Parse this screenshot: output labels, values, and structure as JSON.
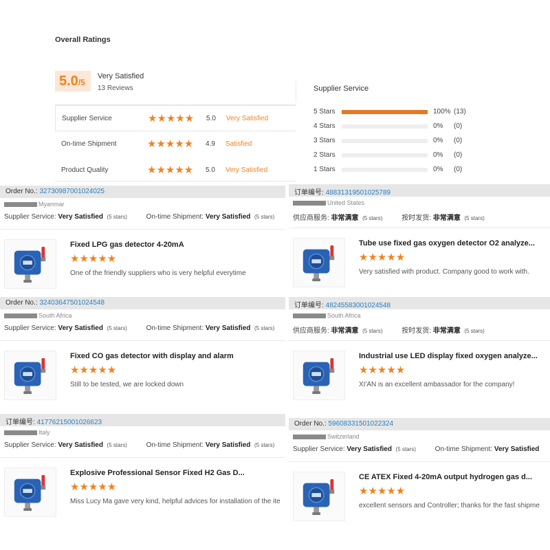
{
  "overall": {
    "title": "Overall Ratings",
    "score": "5.0",
    "score_den": "/5",
    "label": "Very Satisfied",
    "reviews": "13 Reviews"
  },
  "ratings": [
    {
      "label": "Supplier Service",
      "stars": "★★★★★",
      "score": "5.0",
      "word": "Very Satisfied"
    },
    {
      "label": "On-time Shipment",
      "stars": "★★★★★",
      "score": "4.9",
      "word": "Satisfied"
    },
    {
      "label": "Product Quality",
      "stars": "★★★★★",
      "score": "5.0",
      "word": "Very Satisfied"
    }
  ],
  "distribution": {
    "title": "Supplier Service",
    "rows": [
      {
        "label": "5 Stars",
        "pct": "100%",
        "count": "(13)",
        "fraction": 1.0
      },
      {
        "label": "4 Stars",
        "pct": "0%",
        "count": "(0)",
        "fraction": 0
      },
      {
        "label": "3 Stars",
        "pct": "0%",
        "count": "(0)",
        "fraction": 0
      },
      {
        "label": "2 Stars",
        "pct": "0%",
        "count": "(0)",
        "fraction": 0
      },
      {
        "label": "1 Stars",
        "pct": "0%",
        "count": "(0)",
        "fraction": 0
      }
    ]
  },
  "reviews": [
    {
      "order_label": "Order No.:",
      "order_no": "32730987001024025",
      "country": "Myanmar",
      "svc_label": "Supplier Service:",
      "svc_value": "Very Satisfied",
      "svc_stars": "(5 stars)",
      "ship_label": "On-time Shipment:",
      "ship_value": "Very Satisfied",
      "ship_stars": "(5 stars)",
      "product": "Fixed LPG gas detector 4-20mA",
      "stars": "★★★★★",
      "comment": "One of the friendly suppliers who is very helpful everytime"
    },
    {
      "order_label": "订单编号:",
      "order_no": "48831319501025789",
      "country": "United States",
      "svc_label": "供应商服务:",
      "svc_value": "非常满意",
      "svc_stars": "(5 stars)",
      "ship_label": "按时发货:",
      "ship_value": "非常满意",
      "ship_stars": "(5 stars)",
      "product": "Tube use fixed gas oxygen detector O2 analyze...",
      "stars": "★★★★★",
      "comment": "Very satisfied with product. Company good to work with."
    },
    {
      "order_label": "Order No.:",
      "order_no": "32403647501024548",
      "country": "South Africa",
      "svc_label": "Supplier Service:",
      "svc_value": "Very Satisfied",
      "svc_stars": "(5 stars)",
      "ship_label": "On-time Shipment:",
      "ship_value": "Very Satisfied",
      "ship_stars": "(5 stars)",
      "product": "Fixed CO gas detector with display and alarm",
      "stars": "★★★★★",
      "comment": "Still to be tested, we are locked down"
    },
    {
      "order_label": "订单编号:",
      "order_no": "48245583001024548",
      "country": "South Africa",
      "svc_label": "供应商服务:",
      "svc_value": "非常满意",
      "svc_stars": "(5 stars)",
      "ship_label": "按时发货:",
      "ship_value": "非常满意",
      "ship_stars": "(5 stars)",
      "product": "Industrial use LED display fixed oxygen analyze...",
      "stars": "★★★★★",
      "comment": "XI'AN is an excellent ambassador for the company!"
    },
    {
      "order_label": "订单编号:",
      "order_no": "41776215001026623",
      "country": "Italy",
      "svc_label": "Supplier Service:",
      "svc_value": "Very Satisfied",
      "svc_stars": "(5 stars)",
      "ship_label": "On-time Shipment:",
      "ship_value": "Very Satisfied",
      "ship_stars": "(5 stars)",
      "product": "Explosive Professional Sensor Fixed H2 Gas D...",
      "stars": "★★★★★",
      "comment": "Miss Lucy Ma gave very kind, helpful advices for installation of the ite"
    },
    {
      "order_label": "Order No.:",
      "order_no": "59608331501022324",
      "country": "Switzerland",
      "svc_label": "Supplier Service:",
      "svc_value": "Very Satisfied",
      "svc_stars": "(5 stars)",
      "ship_label": "On-time Shipment:",
      "ship_value": "Very Satisfied",
      "ship_stars": "",
      "product": "CE ATEX Fixed 4-20mA output hydrogen gas d...",
      "stars": "★★★★★",
      "comment": "excellent sensors and Controller; thanks for the fast shipme"
    }
  ]
}
